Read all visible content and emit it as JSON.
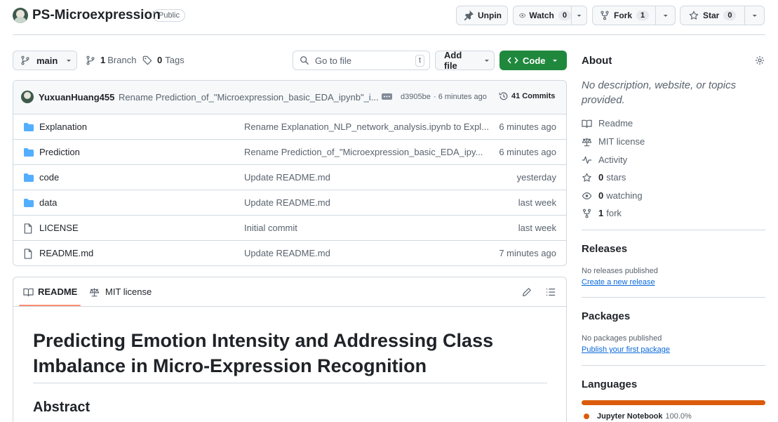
{
  "repo": {
    "name": "PS-Microexpression",
    "visibility": "Public"
  },
  "actions": {
    "unpin": "Unpin",
    "watch": "Watch",
    "watch_count": "0",
    "fork": "Fork",
    "fork_count": "1",
    "star": "Star",
    "star_count": "0"
  },
  "toolbar": {
    "branch": "main",
    "branches_count": "1",
    "branches_label": "Branch",
    "tags_count": "0",
    "tags_label": "Tags",
    "goto_placeholder": "Go to file",
    "goto_key": "t",
    "add_file": "Add file",
    "code": "Code"
  },
  "commit": {
    "author": "YuxuanHuang455",
    "message": "Rename Prediction_of_\"Microexpression_basic_EDA_ipynb\"_i...",
    "hash": "d3905be",
    "time": "· 6 minutes ago",
    "commits": "41 Commits"
  },
  "files": [
    {
      "name": "Explanation",
      "type": "folder",
      "message": "Rename Explanation_NLP_network_analysis.ipynb to Expl...",
      "time": "6 minutes ago"
    },
    {
      "name": "Prediction",
      "type": "folder",
      "message": "Rename Prediction_of_\"Microexpression_basic_EDA_ipy...",
      "time": "6 minutes ago"
    },
    {
      "name": "code",
      "type": "folder",
      "message": "Update README.md",
      "time": "yesterday"
    },
    {
      "name": "data",
      "type": "folder",
      "message": "Update README.md",
      "time": "last week"
    },
    {
      "name": "LICENSE",
      "type": "file",
      "message": "Initial commit",
      "time": "last week"
    },
    {
      "name": "README.md",
      "type": "file",
      "message": "Update README.md",
      "time": "7 minutes ago"
    }
  ],
  "readme": {
    "tab_readme": "README",
    "tab_license": "MIT license",
    "title": "Predicting Emotion Intensity and Addressing Class Imbalance in Micro-Expression Recognition",
    "abstract_heading": "Abstract"
  },
  "about": {
    "heading": "About",
    "description": "No description, website, or topics provided.",
    "readme": "Readme",
    "license": "MIT license",
    "activity": "Activity",
    "stars_count": "0",
    "stars_label": "stars",
    "watching_count": "0",
    "watching_label": "watching",
    "forks_count": "1",
    "forks_label": "fork"
  },
  "releases": {
    "heading": "Releases",
    "empty": "No releases published",
    "link": "Create a new release"
  },
  "packages": {
    "heading": "Packages",
    "empty": "No packages published",
    "link": "Publish your first package"
  },
  "languages": {
    "heading": "Languages",
    "items": [
      {
        "name": "Jupyter Notebook",
        "percent": "100.0%",
        "share": 1.0,
        "color": "#DA5B0B"
      }
    ]
  },
  "colors": {
    "accent_green": "#1f883d",
    "link_blue": "#0969da",
    "folder_blue": "#54aeff",
    "underline_orange": "#fd8c73"
  }
}
